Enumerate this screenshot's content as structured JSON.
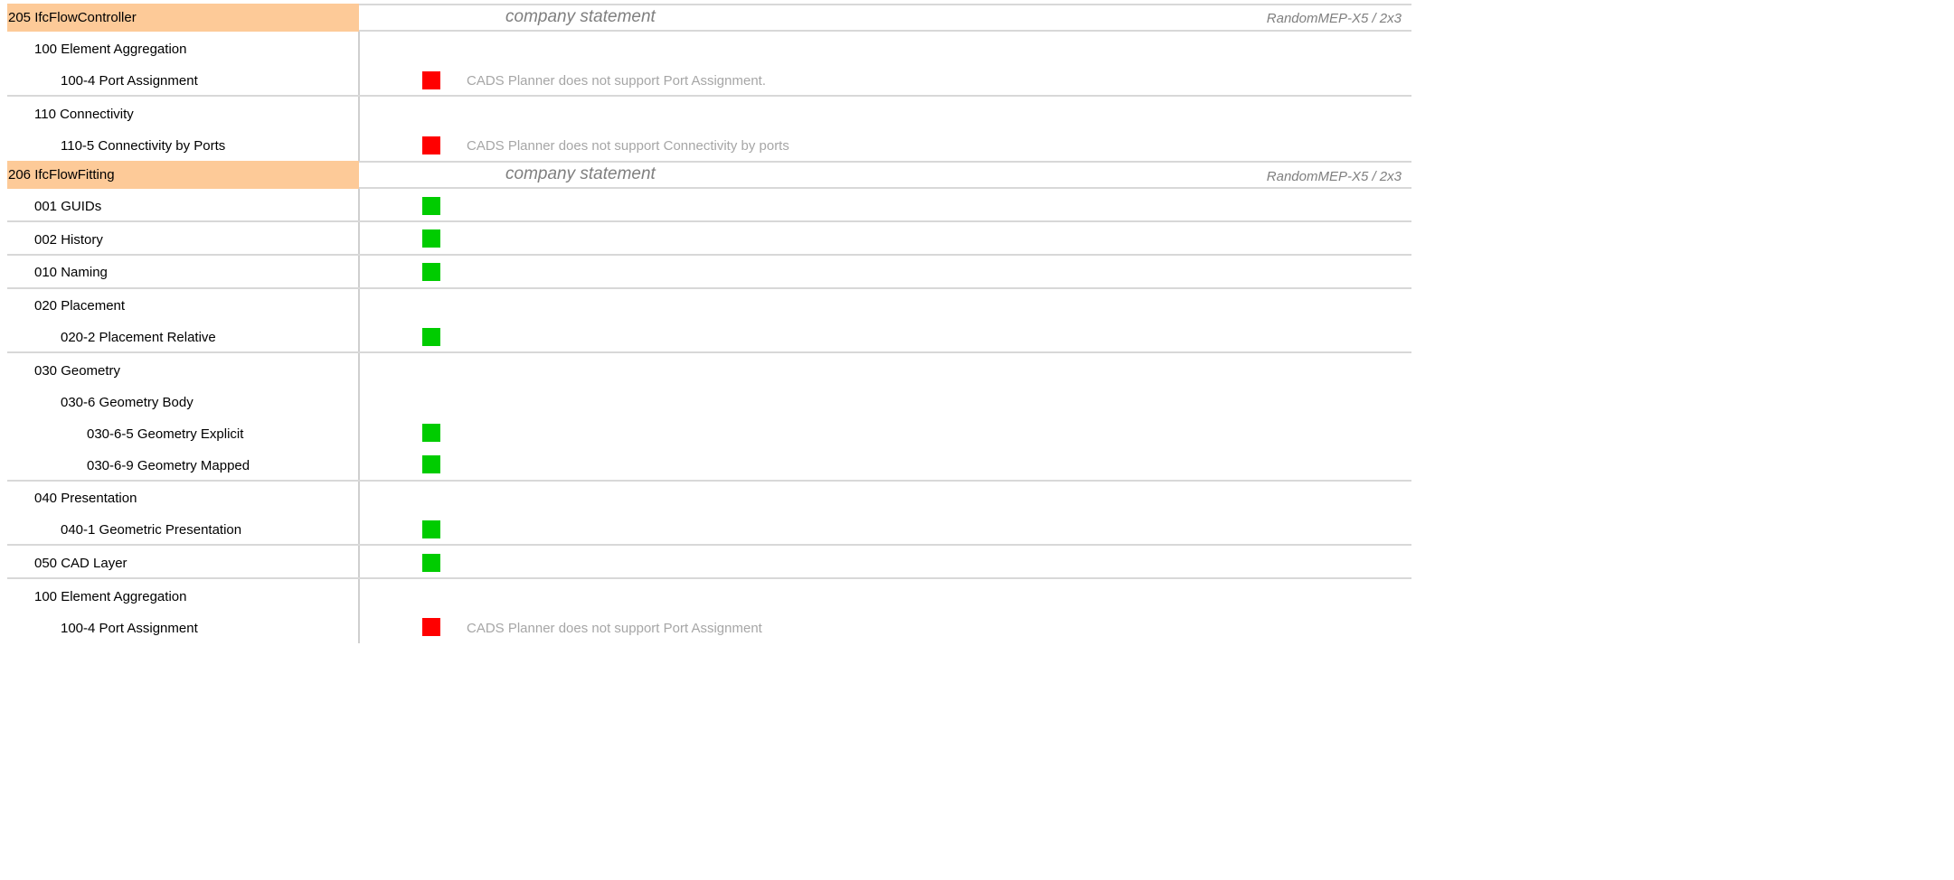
{
  "sections": [
    {
      "header": {
        "label": "205 IfcFlowController",
        "company": "company statement",
        "product": "RandomMEP-X5 / 2x3"
      },
      "items": [
        {
          "label": "100 Element Aggregation"
        },
        {
          "label": "100-4 Port Assignment",
          "status": "red",
          "note": "CADS Planner does not support Port Assignment."
        },
        {
          "label": "110 Connectivity"
        },
        {
          "label": "110-5 Connectivity by Ports",
          "status": "red",
          "note": "CADS Planner does not support Connectivity by ports"
        }
      ]
    },
    {
      "header": {
        "label": "206 IfcFlowFitting",
        "company": "company statement",
        "product": "RandomMEP-X5 / 2x3"
      },
      "items": [
        {
          "label": "001 GUIDs",
          "status": "green"
        },
        {
          "label": "002 History",
          "status": "green"
        },
        {
          "label": "010 Naming",
          "status": "green"
        },
        {
          "label": "020 Placement"
        },
        {
          "label": "020-2 Placement Relative",
          "status": "green"
        },
        {
          "label": "030 Geometry"
        },
        {
          "label": "030-6 Geometry Body"
        },
        {
          "label": "030-6-5 Geometry Explicit",
          "status": "green"
        },
        {
          "label": "030-6-9 Geometry Mapped",
          "status": "green"
        },
        {
          "label": "040 Presentation"
        },
        {
          "label": "040-1 Geometric Presentation",
          "status": "green"
        },
        {
          "label": "050 CAD Layer",
          "status": "green"
        },
        {
          "label": "100 Element Aggregation"
        },
        {
          "label": "100-4 Port Assignment",
          "status": "red",
          "note": "CADS Planner does not support Port Assignment"
        }
      ]
    }
  ],
  "colors": {
    "header_bg": "#fdca98",
    "ok": "#00cc00",
    "fail": "#ff0000"
  }
}
